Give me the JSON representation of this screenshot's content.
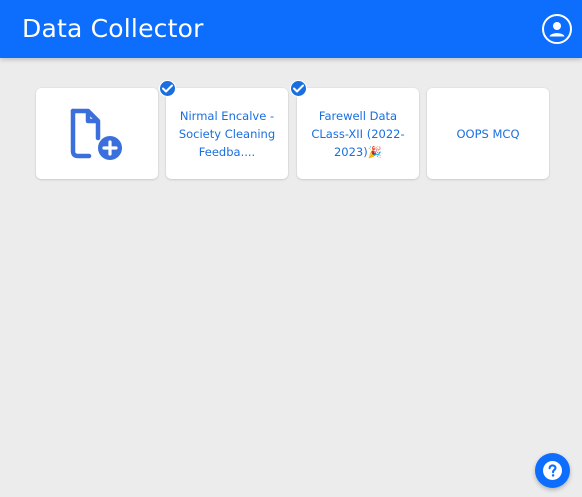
{
  "app": {
    "title": "Data Collector"
  },
  "header": {
    "account_icon": "user-circle-icon",
    "background_color": "#0d6efd"
  },
  "forms": {
    "new_form_icon": "file-add-icon",
    "items": [
      {
        "title": "Nirmal Encalve - Society Cleaning Feedba....",
        "selected": true
      },
      {
        "title": "Farewell Data CLass-XII (2022-2023)🎉",
        "selected": true
      },
      {
        "title": "OOPS MCQ",
        "selected": false
      }
    ]
  },
  "help": {
    "icon": "question-circle-icon"
  },
  "colors": {
    "accent": "#0d6efd",
    "link_text": "#1a6fe0",
    "new_form_icon": "#3b6fdc",
    "page_background": "#ececec"
  }
}
